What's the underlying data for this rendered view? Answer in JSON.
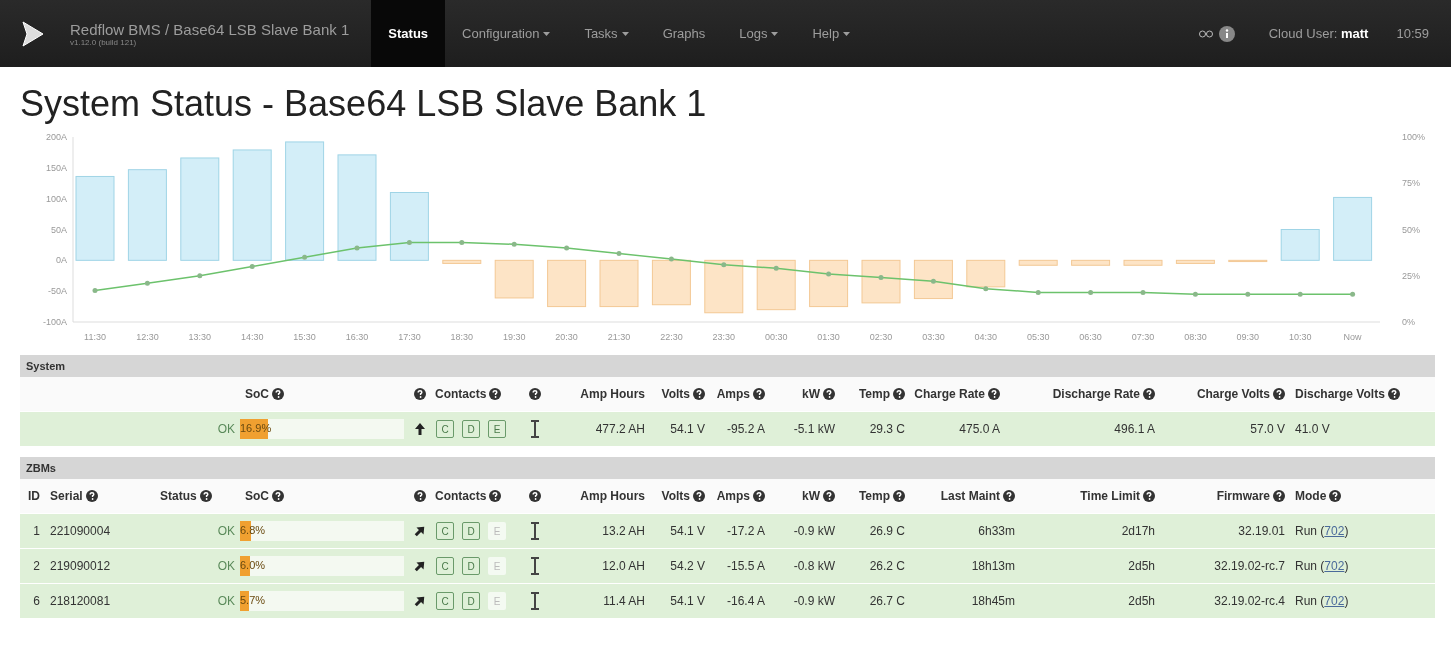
{
  "navbar": {
    "brand": "Redflow BMS / Base64 LSB Slave Bank 1",
    "version": "v1.12.0 (build 121)",
    "menu": [
      {
        "label": "Status",
        "selected": true,
        "dropdown": false
      },
      {
        "label": "Configuration",
        "selected": false,
        "dropdown": true
      },
      {
        "label": "Tasks",
        "selected": false,
        "dropdown": true
      },
      {
        "label": "Graphs",
        "selected": false,
        "dropdown": false
      },
      {
        "label": "Logs",
        "selected": false,
        "dropdown": true
      },
      {
        "label": "Help",
        "selected": false,
        "dropdown": true
      }
    ],
    "user_label": "Cloud User:",
    "user_name": "matt",
    "time": "10:59"
  },
  "title": "System Status - Base64 LSB Slave Bank 1",
  "chart": {
    "chart_data": {
      "type": "bar",
      "categories": [
        "11:30",
        "12:30",
        "13:30",
        "14:30",
        "15:30",
        "16:30",
        "17:30",
        "18:30",
        "19:30",
        "20:30",
        "21:30",
        "22:30",
        "23:30",
        "00:30",
        "01:30",
        "02:30",
        "03:30",
        "04:30",
        "05:30",
        "06:30",
        "07:30",
        "08:30",
        "09:30",
        "10:30",
        "Now"
      ],
      "stacked": true,
      "series": [
        {
          "color": "#d3eef8",
          "values": [
            136,
            147,
            166,
            179,
            192,
            171,
            110,
            null,
            null,
            null,
            null,
            null,
            null,
            null,
            null,
            null,
            null,
            null,
            null,
            null,
            null,
            null,
            null,
            50,
            102
          ]
        },
        {
          "color": "#fde4c6",
          "values": [
            null,
            null,
            null,
            null,
            null,
            null,
            null,
            -5,
            -61,
            -75,
            -75,
            -72,
            -85,
            -80,
            -75,
            -69,
            -62,
            -43,
            -8,
            -8,
            -8,
            -5,
            -2,
            null,
            null
          ]
        },
        {
          "type": "line",
          "axis": "y2",
          "color": "#6cc26c",
          "values": [
            17,
            21,
            25,
            30,
            35,
            40,
            43,
            43,
            42,
            40,
            37,
            34,
            31,
            29,
            26,
            24,
            22,
            18,
            16,
            16,
            16,
            15,
            15,
            15,
            15
          ]
        }
      ],
      "ylim": [
        -100,
        200
      ],
      "yticks": [
        {
          "value": 200,
          "label": "200A"
        },
        {
          "value": 150,
          "label": "150A"
        },
        {
          "value": 100,
          "label": "100A"
        },
        {
          "value": 50,
          "label": "50A"
        },
        {
          "value": 0,
          "label": "0A"
        },
        {
          "value": -50,
          "label": "-50A"
        },
        {
          "value": -100,
          "label": "-100A"
        }
      ],
      "y2lim": [
        0,
        100
      ],
      "y2ticks": [
        {
          "value": 100,
          "label": "100%"
        },
        {
          "value": 75,
          "label": "75%"
        },
        {
          "value": 50,
          "label": "50%"
        },
        {
          "value": 25,
          "label": "25%"
        },
        {
          "value": 0,
          "label": "0%"
        }
      ]
    }
  },
  "system": {
    "heading": "System",
    "columns": [
      {
        "help": false
      },
      {
        "label": "SoC",
        "help": true
      },
      {
        "help": true
      },
      {
        "label": "Contacts",
        "help": true
      },
      {
        "help": true
      },
      {
        "label": "Amp Hours",
        "help": false
      },
      {
        "label": "Volts",
        "help": true
      },
      {
        "label": "Amps",
        "help": true
      },
      {
        "label": "kW",
        "help": true
      },
      {
        "label": "Temp",
        "help": true
      },
      {
        "label": "Charge Rate",
        "help": true
      },
      {
        "label": "Discharge Rate",
        "help": true
      },
      {
        "label": "Charge Volts",
        "help": true
      },
      {
        "label": "Discharge Volts",
        "help": true
      }
    ],
    "row": {
      "status": "OK",
      "soc": {
        "text": "16.9%",
        "level": 0.169
      },
      "contacts": [
        {
          "label": "C",
          "closed": true
        },
        {
          "label": "D",
          "closed": true
        },
        {
          "label": "E",
          "closed": true
        }
      ],
      "values": [
        "477.2 AH",
        "54.1 V",
        "-95.2 A",
        "-5.1 kW",
        "29.3 C",
        "475.0 A",
        "496.1 A",
        "57.0 V",
        "41.0 V"
      ]
    }
  },
  "zbms": {
    "heading": "ZBMs",
    "columns": [
      {
        "label": "ID",
        "help": false
      },
      {
        "label": "Serial",
        "help": true
      },
      {
        "label": "Status",
        "help": true
      },
      {
        "label": "SoC",
        "help": true
      },
      {
        "help": true
      },
      {
        "label": "Contacts",
        "help": true
      },
      {
        "help": true
      },
      {
        "label": "Amp Hours",
        "help": false
      },
      {
        "label": "Volts",
        "help": true
      },
      {
        "label": "Amps",
        "help": true
      },
      {
        "label": "kW",
        "help": true
      },
      {
        "label": "Temp",
        "help": true
      },
      {
        "label": "Last Maint",
        "help": true
      },
      {
        "label": "Time Limit",
        "help": true
      },
      {
        "label": "Firmware",
        "help": true
      },
      {
        "label": "Mode",
        "help": true
      }
    ],
    "rows": [
      {
        "id": "1",
        "serial": "221090004",
        "status": "OK",
        "soc": {
          "text": "6.8%",
          "level": 0.068
        },
        "contacts": [
          {
            "label": "C",
            "closed": true
          },
          {
            "label": "D",
            "closed": true
          },
          {
            "label": "E",
            "closed": false
          }
        ],
        "values": [
          "13.2 AH",
          "54.1 V",
          "-17.2 A",
          "-0.9 kW",
          "26.9 C",
          "6h33m",
          "2d17h",
          "32.19.01"
        ],
        "mode": {
          "prefix": "Run (",
          "link": "702",
          "suffix": ")"
        }
      },
      {
        "id": "2",
        "serial": "219090012",
        "status": "OK",
        "soc": {
          "text": "6.0%",
          "level": 0.06
        },
        "contacts": [
          {
            "label": "C",
            "closed": true
          },
          {
            "label": "D",
            "closed": true
          },
          {
            "label": "E",
            "closed": false
          }
        ],
        "values": [
          "12.0 AH",
          "54.2 V",
          "-15.5 A",
          "-0.8 kW",
          "26.2 C",
          "18h13m",
          "2d5h",
          "32.19.02-rc.7"
        ],
        "mode": {
          "prefix": "Run (",
          "link": "702",
          "suffix": ")"
        }
      },
      {
        "id": "6",
        "serial": "218120081",
        "status": "OK",
        "soc": {
          "text": "5.7%",
          "level": 0.057
        },
        "contacts": [
          {
            "label": "C",
            "closed": true
          },
          {
            "label": "D",
            "closed": true
          },
          {
            "label": "E",
            "closed": false
          }
        ],
        "values": [
          "11.4 AH",
          "54.1 V",
          "-16.4 A",
          "-0.9 kW",
          "26.7 C",
          "18h45m",
          "2d5h",
          "32.19.02-rc.4"
        ],
        "mode": {
          "prefix": "Run (",
          "link": "702",
          "suffix": ")"
        }
      }
    ]
  }
}
